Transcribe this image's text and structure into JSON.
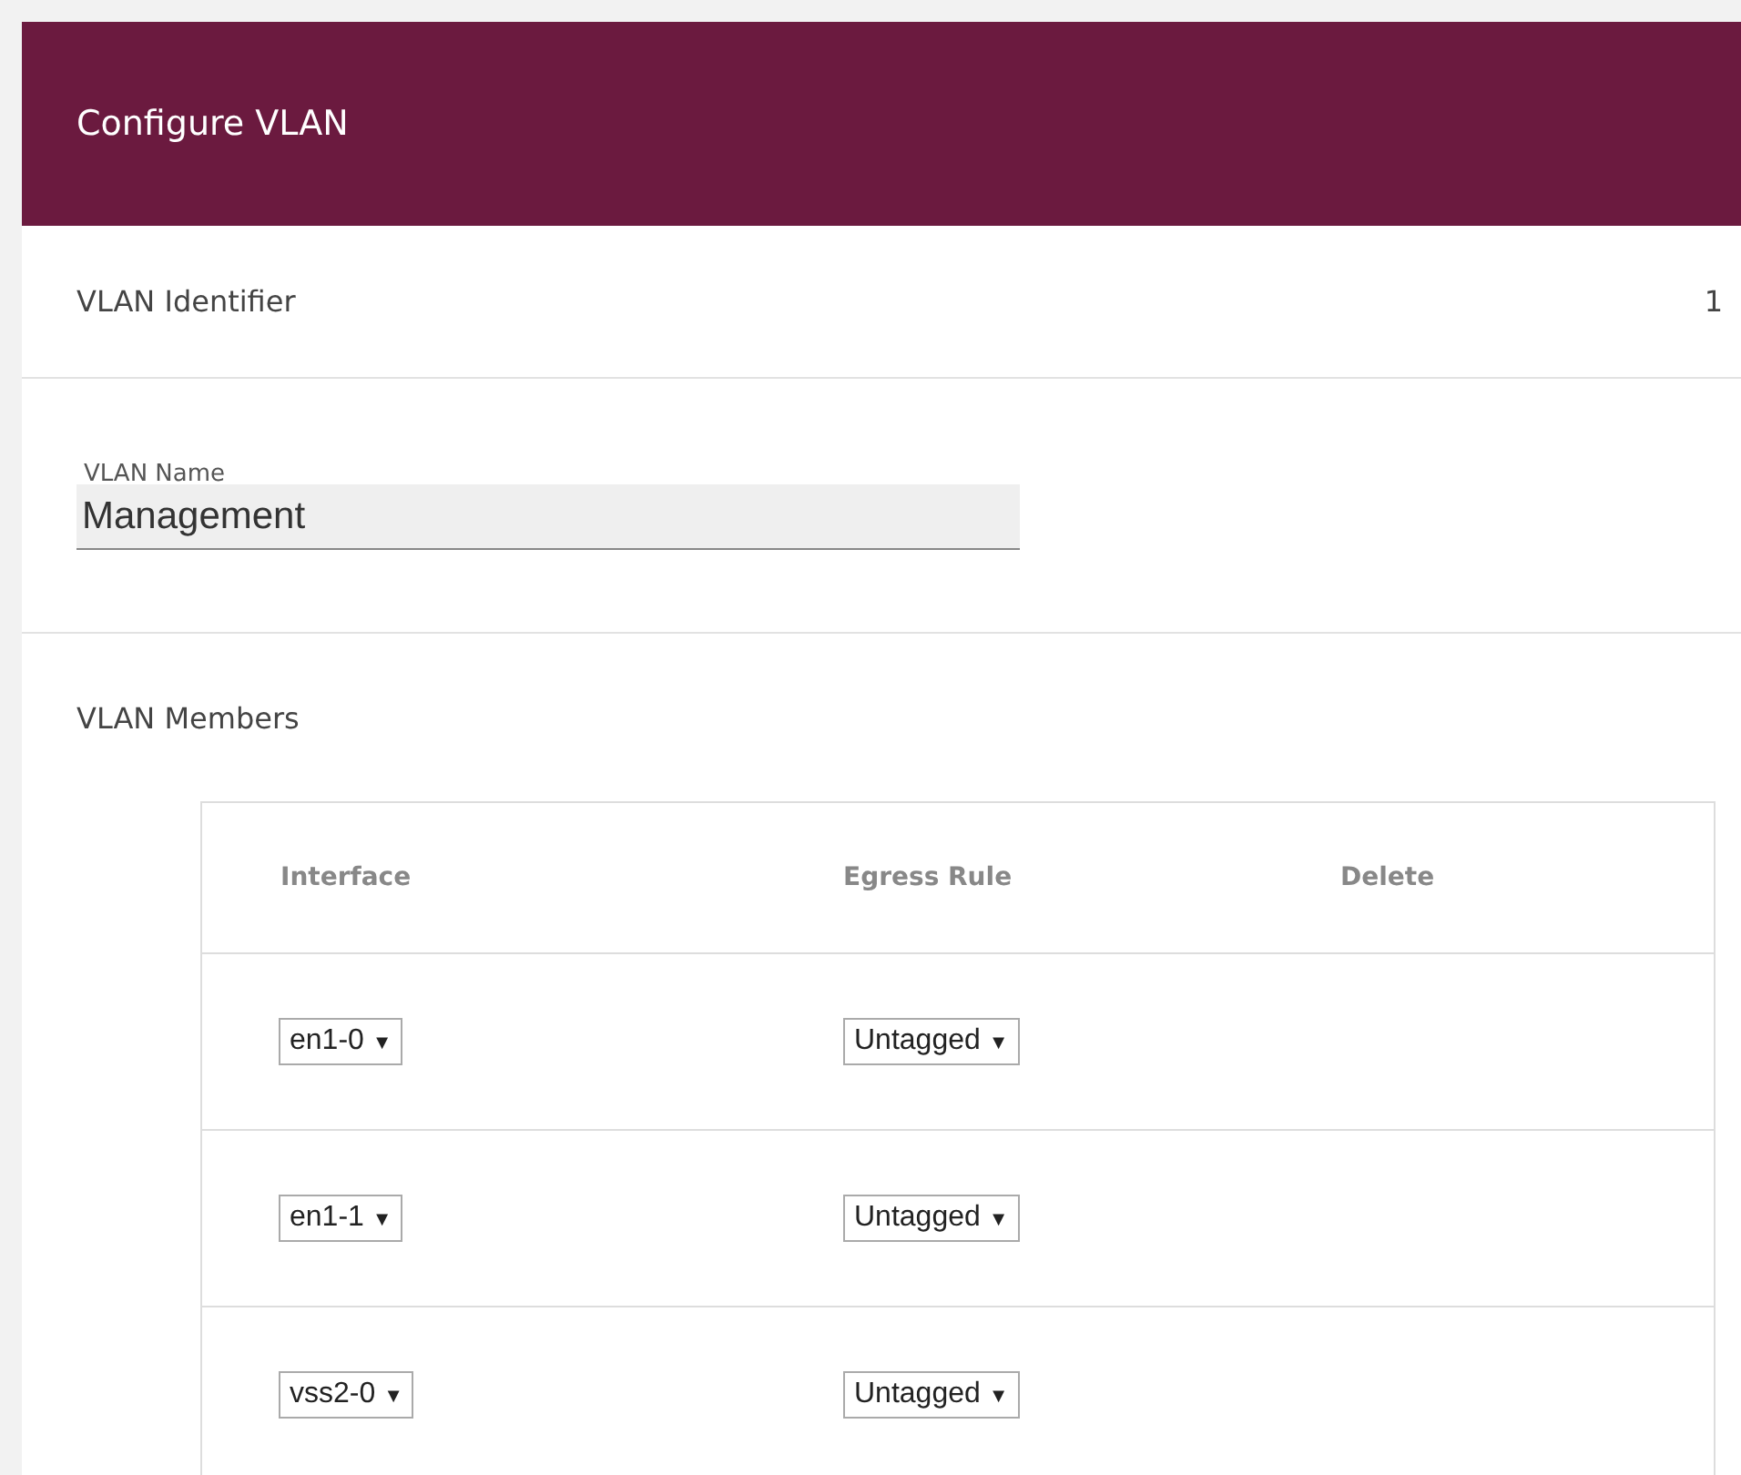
{
  "header": {
    "title": "Configure VLAN"
  },
  "identifier": {
    "label": "VLAN Identifier",
    "value": "1"
  },
  "name_field": {
    "label": "VLAN Name",
    "value": "Management"
  },
  "members": {
    "label": "VLAN Members",
    "columns": [
      "Interface",
      "Egress Rule",
      "Delete"
    ],
    "rows": [
      {
        "interface": {
          "value": "en1-0",
          "arrow": "▼"
        },
        "egress": {
          "value": "Untagged",
          "arrow": "▼"
        }
      },
      {
        "interface": {
          "value": "en1-1",
          "arrow": "▼"
        },
        "egress": {
          "value": "Untagged",
          "arrow": "▼"
        }
      },
      {
        "interface": {
          "value": "vss2-0",
          "arrow": "▼"
        },
        "egress": {
          "value": "Untagged",
          "arrow": "▼"
        }
      }
    ]
  }
}
